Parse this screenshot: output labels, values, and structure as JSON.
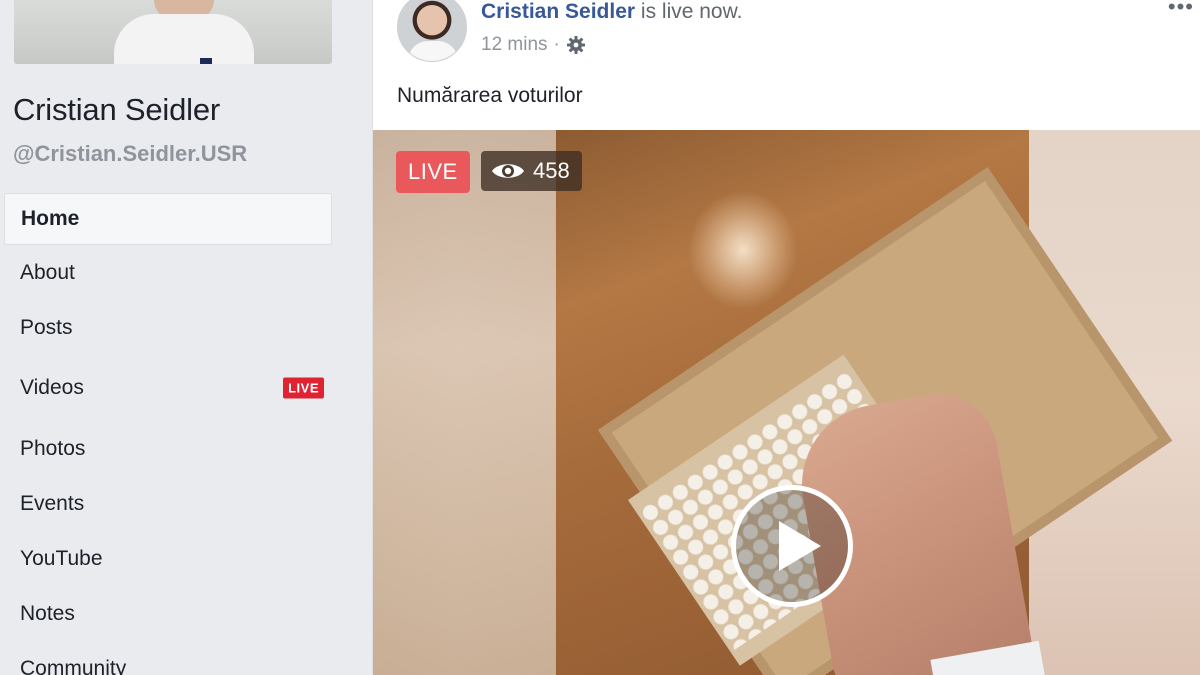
{
  "page": {
    "name": "Cristian Seidler",
    "handle": "@Cristian.Seidler.USR"
  },
  "sidebar": {
    "items": [
      {
        "label": "Home",
        "active": true
      },
      {
        "label": "About"
      },
      {
        "label": "Posts"
      },
      {
        "label": "Videos",
        "badge": "LIVE"
      },
      {
        "label": "Photos"
      },
      {
        "label": "Events"
      },
      {
        "label": "YouTube"
      },
      {
        "label": "Notes"
      },
      {
        "label": "Community"
      }
    ]
  },
  "post": {
    "author": "Cristian Seidler",
    "status_suffix": " is live now.",
    "time": "12 mins",
    "separator": "·",
    "privacy_icon": "gear-icon",
    "text": "Numărarea voturilor",
    "more_icon": "more-icon",
    "video": {
      "live_label": "LIVE",
      "viewer_count": "458",
      "viewer_icon": "eye-icon",
      "play_icon": "play-icon"
    }
  },
  "colors": {
    "link_blue": "#385898",
    "live_red": "#e9595c",
    "live_tag_red": "#e02332",
    "sidebar_bg": "#e9ebee"
  }
}
